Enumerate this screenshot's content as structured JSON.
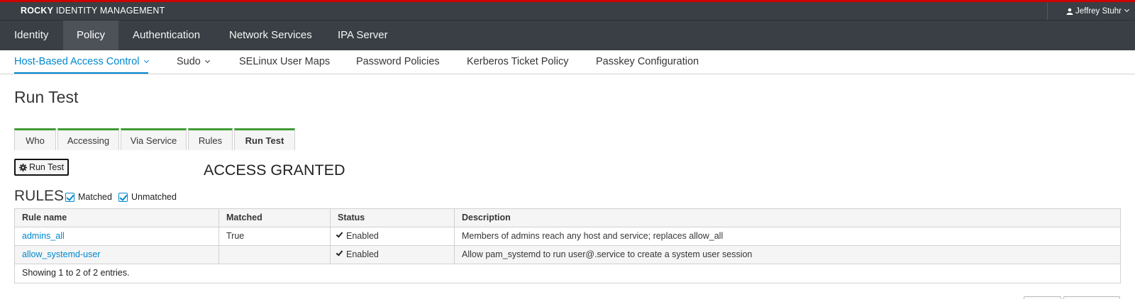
{
  "colors": {
    "accent": "#0088ce",
    "brand_bar": "#cc0000",
    "nav_bg": "#393f44",
    "tab_green": "#3f9c35"
  },
  "header": {
    "brand_bold": "ROCKY",
    "brand_rest": " IDENTITY MANAGEMENT",
    "user_name": "Jeffrey Stuhr",
    "user_icon": "user-icon"
  },
  "main_nav": [
    "Identity",
    "Policy",
    "Authentication",
    "Network Services",
    "IPA Server"
  ],
  "main_nav_active": "Policy",
  "sub_nav": [
    {
      "label": "Host-Based Access Control",
      "dropdown": true,
      "active": true
    },
    {
      "label": "Sudo",
      "dropdown": true
    },
    {
      "label": "SELinux User Maps"
    },
    {
      "label": "Password Policies"
    },
    {
      "label": "Kerberos Ticket Policy"
    },
    {
      "label": "Passkey Configuration"
    }
  ],
  "page": {
    "title": "Run Test",
    "tabs": [
      "Who",
      "Accessing",
      "Via Service",
      "Rules",
      "Run Test"
    ],
    "active_tab": "Run Test",
    "run_button": "Run Test",
    "result": "ACCESS GRANTED"
  },
  "rules": {
    "heading": "RULES",
    "filters": [
      {
        "label": "Matched",
        "checked": true
      },
      {
        "label": "Unmatched",
        "checked": true
      }
    ],
    "columns": [
      "Rule name",
      "Matched",
      "Status",
      "Description"
    ],
    "rows": [
      {
        "name": "admins_all",
        "matched": "True",
        "status": "Enabled",
        "description": "Members of admins reach any host and service; replaces allow_all"
      },
      {
        "name": "allow_systemd-user",
        "matched": "",
        "status": "Enabled",
        "description": "Allow pam_systemd to run user@.service to create a system user session"
      }
    ],
    "footer": "Showing 1 to 2 of 2 entries."
  }
}
